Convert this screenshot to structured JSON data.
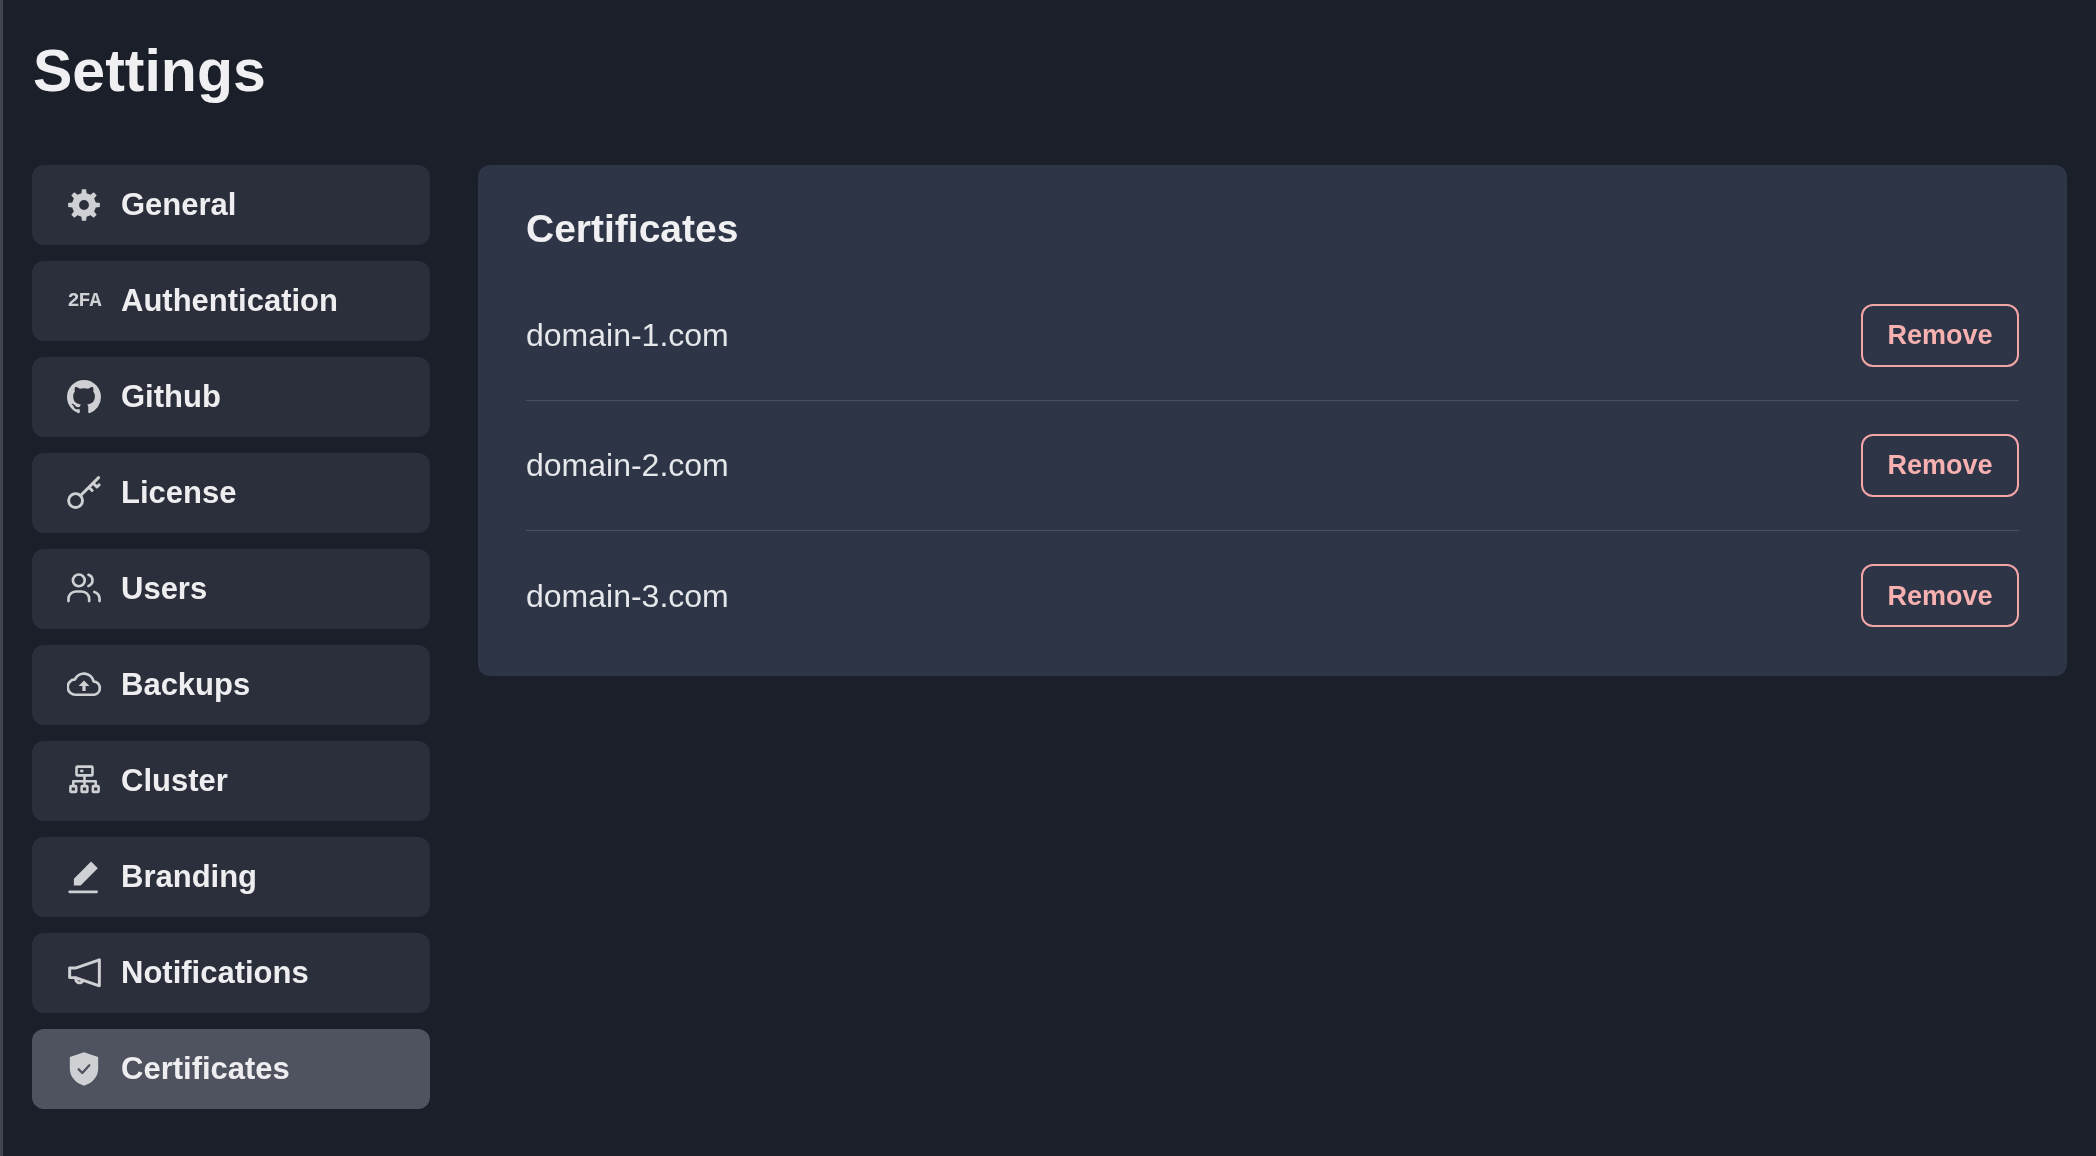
{
  "page": {
    "title": "Settings"
  },
  "sidebar": {
    "items": [
      {
        "label": "General",
        "selected": false
      },
      {
        "label": "Authentication",
        "icon_text": "2FA",
        "selected": false
      },
      {
        "label": "Github",
        "selected": false
      },
      {
        "label": "License",
        "selected": false
      },
      {
        "label": "Users",
        "selected": false
      },
      {
        "label": "Backups",
        "selected": false
      },
      {
        "label": "Cluster",
        "selected": false
      },
      {
        "label": "Branding",
        "selected": false
      },
      {
        "label": "Notifications",
        "selected": false
      },
      {
        "label": "Certificates",
        "selected": true
      }
    ]
  },
  "panel": {
    "title": "Certificates",
    "rows": [
      {
        "domain": "domain-1.com",
        "action": "Remove"
      },
      {
        "domain": "domain-2.com",
        "action": "Remove"
      },
      {
        "domain": "domain-3.com",
        "action": "Remove"
      }
    ]
  }
}
